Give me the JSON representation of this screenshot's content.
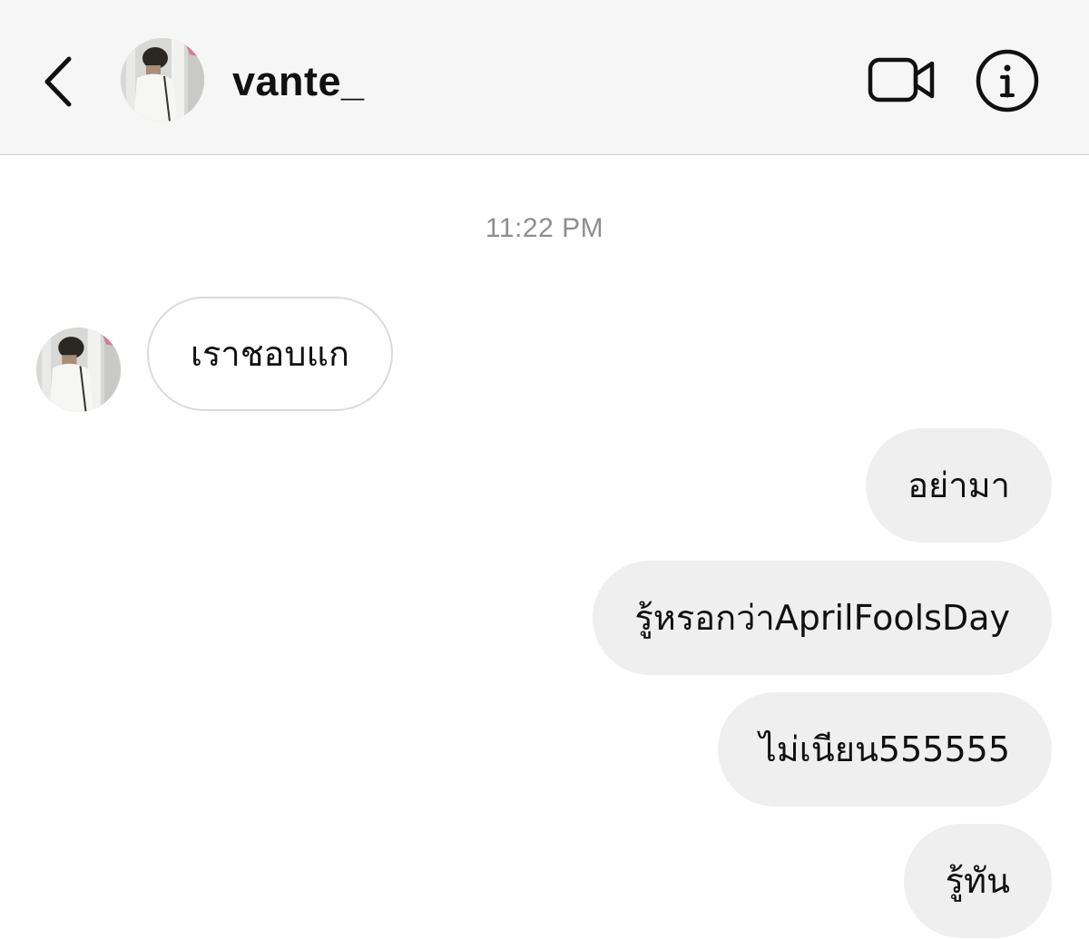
{
  "header": {
    "back_icon": "chevron-left-icon",
    "avatar_icon": "profile-photo",
    "username": "vante_",
    "video_call_icon": "video-camera-icon",
    "info_icon": "info-circle-icon"
  },
  "conversation": {
    "timestamp": "11:22 PM",
    "received": [
      {
        "text": "เราชอบแก"
      }
    ],
    "sent": [
      {
        "text": "อย่ามา"
      },
      {
        "text": "รู้หรอกว่าAprilFoolsDay"
      },
      {
        "text": "ไม่เนียน555555"
      },
      {
        "text": "รู้ทัน"
      }
    ]
  },
  "colors": {
    "header_bg": "#f6f6f6",
    "sent_bubble_bg": "#efefef",
    "received_bubble_border": "#dbdbdb",
    "timestamp_text": "#8e8e8e"
  }
}
